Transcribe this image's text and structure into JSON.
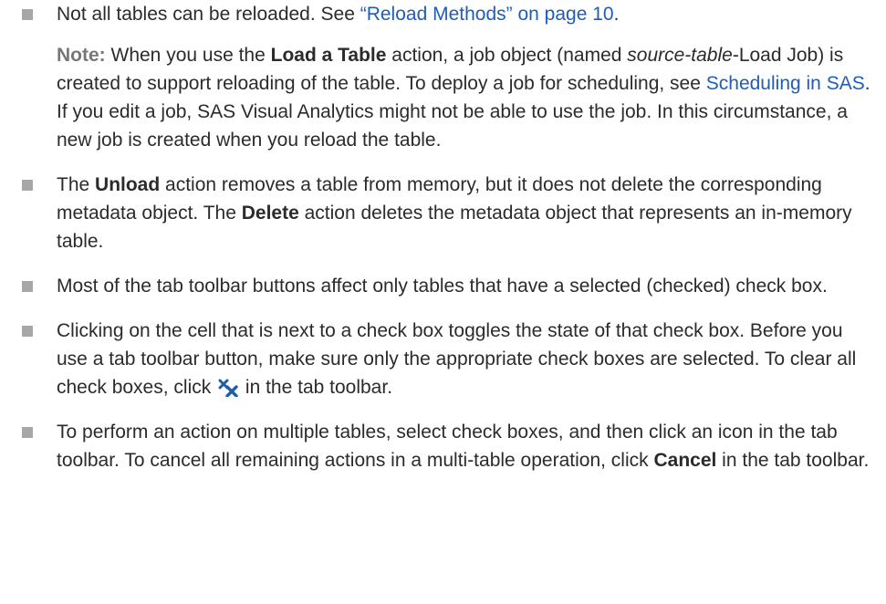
{
  "bullets": [
    {
      "text_before_link": "Not all tables can be reloaded. See ",
      "link": "“Reload Methods” on page 10",
      "text_after_link": ".",
      "note": {
        "label": "Note:",
        "t1": "  When you use the ",
        "b1": "Load a Table",
        "t2": " action, a job object (named ",
        "i1": "source-table",
        "t3": "-Load Job) is created to support reloading of the table. To deploy a job for scheduling, see ",
        "link": "Scheduling in SAS",
        "t4": ". If you edit a job, SAS Visual Analytics might not be able to use the job. In this circumstance, a new job is created when you reload the table."
      }
    },
    {
      "t1": "The ",
      "b1": "Unload",
      "t2": " action removes a table from memory, but it does not delete the corresponding metadata object. The ",
      "b2": "Delete",
      "t3": " action deletes the metadata object that represents an in-memory table."
    },
    {
      "t1": "Most of the tab toolbar buttons affect only tables that have a selected (checked) check box."
    },
    {
      "t1": "Clicking on the cell that is next to a check box toggles the state of that check box. Before you use a tab toolbar button, make sure only the appropriate check boxes are selected. To clear all check boxes, click ",
      "icon": "clear-selections-icon",
      "t2": " in the tab toolbar."
    },
    {
      "t1": "To perform an action on multiple tables, select check boxes, and then click an icon in the tab toolbar. To cancel all remaining actions in a multi-table operation, click ",
      "b1": "Cancel",
      "t2": " in the tab toolbar."
    }
  ],
  "colors": {
    "text": "#2b2b2b",
    "link": "#1f5db8",
    "bullet": "#a7a7a7",
    "note_label": "#777777",
    "icon_blue": "#1d5fa6"
  }
}
